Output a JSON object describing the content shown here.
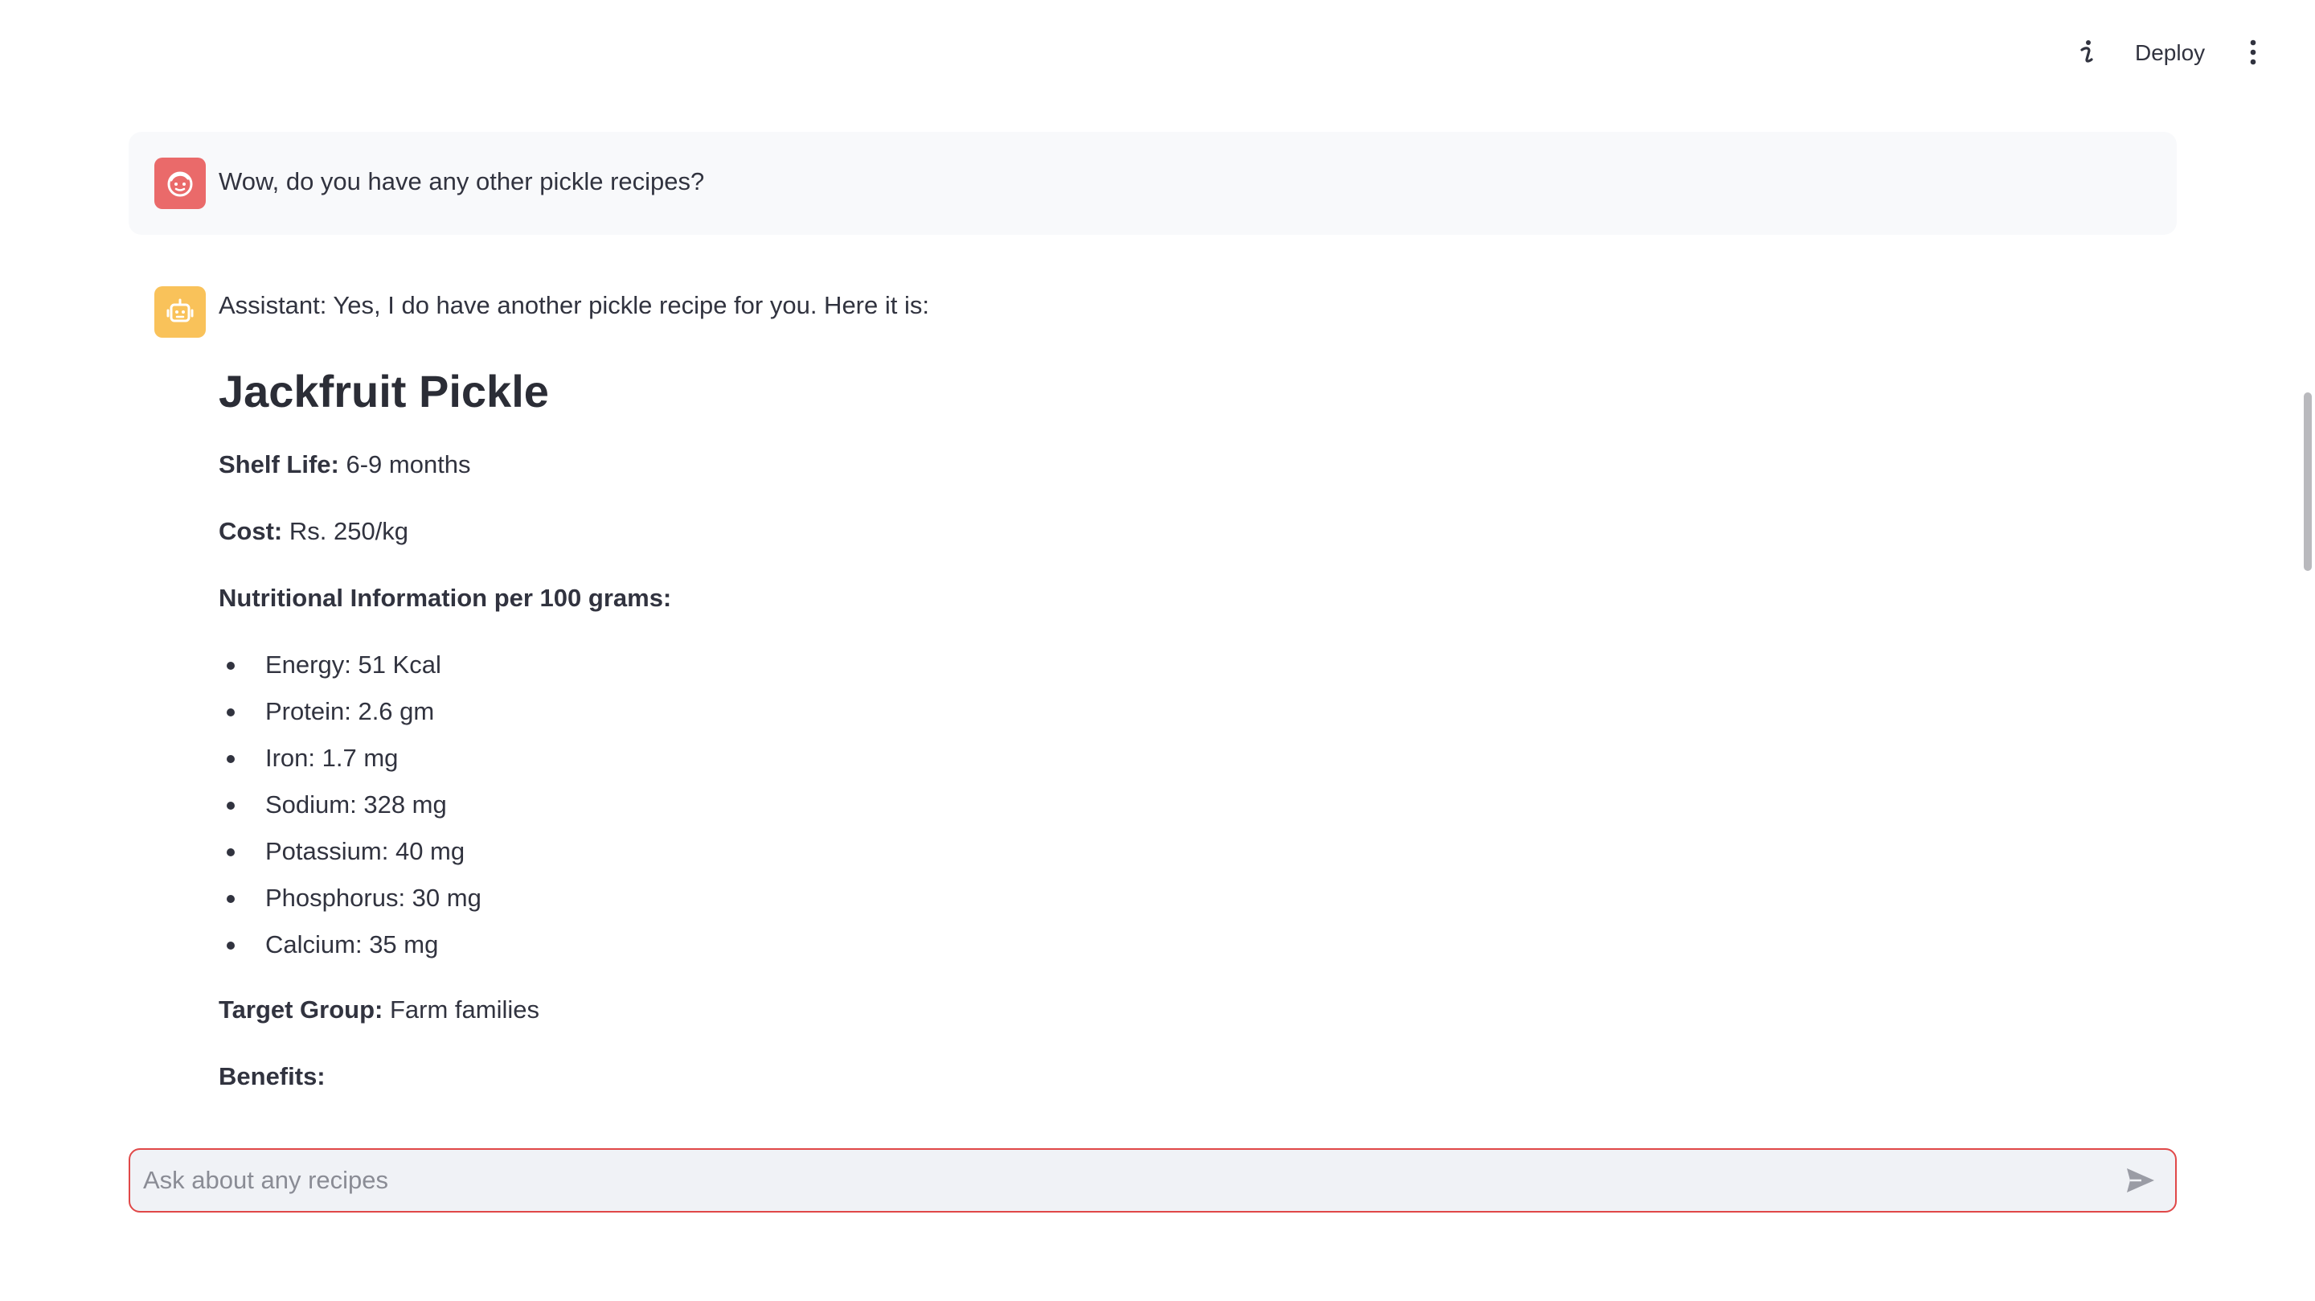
{
  "header": {
    "deploy_label": "Deploy",
    "icons": [
      "info-icon",
      "more-vertical-icon"
    ]
  },
  "conversation": {
    "user_message": {
      "avatar_icon": "user-face-icon",
      "avatar_color": "#ea6a6a",
      "text": "Wow, do you have any other pickle recipes?"
    },
    "assistant_message": {
      "avatar_icon": "robot-icon",
      "avatar_color": "#f9c25a",
      "intro": "Assistant: Yes, I do have another pickle recipe for you. Here it is:",
      "recipe": {
        "title": "Jackfruit Pickle",
        "shelf_life_label": "Shelf Life:",
        "shelf_life_value": "6-9 months",
        "cost_label": "Cost:",
        "cost_value": "Rs. 250/kg",
        "nutrition_heading": "Nutritional Information per 100 grams:",
        "nutrition": [
          "Energy: 51 Kcal",
          "Protein: 2.6 gm",
          "Iron: 1.7 mg",
          "Sodium: 328 mg",
          "Potassium: 40 mg",
          "Phosphorus: 30 mg",
          "Calcium: 35 mg"
        ],
        "target_group_label": "Target Group:",
        "target_group_value": "Farm families",
        "benefits_label": "Benefits:"
      }
    }
  },
  "chat_input": {
    "placeholder": "Ask about any recipes",
    "value": "",
    "send_icon": "send-icon",
    "focus_border_color": "#e04848"
  }
}
